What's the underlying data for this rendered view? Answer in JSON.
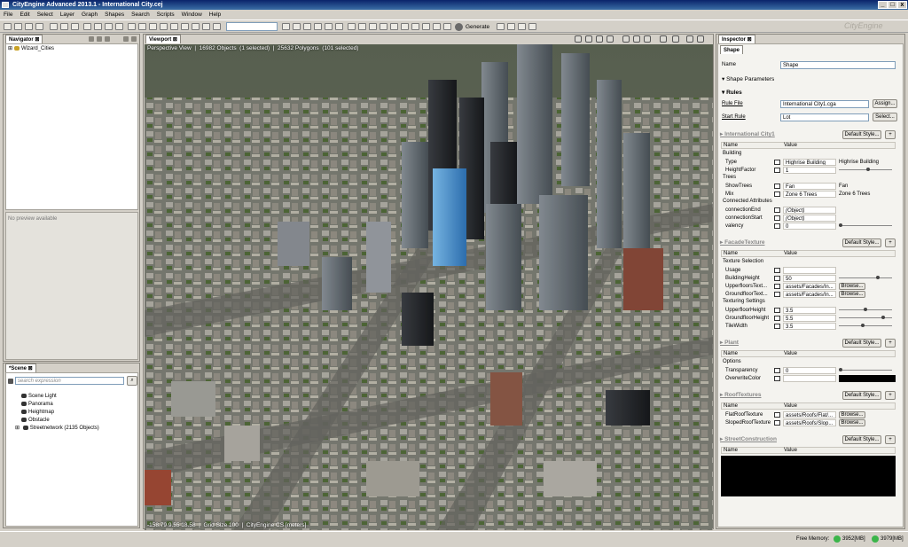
{
  "window": {
    "title": "CityEngine Advanced 2013.1 - International City.cej"
  },
  "menu": [
    "File",
    "Edit",
    "Select",
    "Layer",
    "Graph",
    "Shapes",
    "Search",
    "Scripts",
    "Window",
    "Help"
  ],
  "toolbar": {
    "generate_label": "Generate",
    "brand_watermark": "CityEngine"
  },
  "navigator": {
    "tab": "Navigator",
    "tree_root": "Wizard_Cities",
    "preview_text": "No preview available"
  },
  "scene": {
    "tab": "*Scene",
    "search_placeholder": "search expression",
    "items": [
      "Scene Light",
      "Panorama",
      "Heightmap",
      "Obstacle",
      "Streetnetwork (2135 Objects)"
    ]
  },
  "viewport": {
    "tab": "Viewport",
    "info": "Perspective View  |  16982 Objects  (1 selected)  |  25632 Polygons  (101 selected)",
    "footer": "-158.79 9.55 18.58  |  Grid Size 100  |  CityEngine CS [meters]"
  },
  "inspector": {
    "tab": "Inspector",
    "subtab": "Shape",
    "name_label": "Name",
    "name_value": "Shape",
    "shape_params": "Shape Parameters",
    "rules_header": "Rules",
    "rule_file_label": "Rule File",
    "rule_file_value": "International City1.cga",
    "assign_button": "Assign...",
    "start_rule_label": "Start Rule",
    "start_rule_value": "Lot",
    "select_button": "Select...",
    "col_name": "Name",
    "col_value": "Value",
    "default_style": "Default Style...",
    "browse": "Browse...",
    "sections": [
      {
        "title": "International City1",
        "groups": [
          {
            "label": "Building",
            "rows": [
              {
                "n": "Type",
                "v": "Highrise Building",
                "x": "Highrise Building"
              },
              {
                "n": "HeightFactor",
                "v": "1",
                "slider": 0.55
              }
            ]
          },
          {
            "label": "Trees",
            "rows": [
              {
                "n": "ShowTrees",
                "v": "Fan",
                "x": "Fan"
              },
              {
                "n": "Mix",
                "v": "Zone 6 Trees",
                "x": "Zone 6 Trees"
              }
            ]
          },
          {
            "label": "Connected Attributes",
            "rows": [
              {
                "n": "connectionEnd",
                "v": "(Object)"
              },
              {
                "n": "connectionStart",
                "v": "(Object)"
              },
              {
                "n": "valency",
                "v": "0",
                "slider": 0.0
              }
            ]
          }
        ]
      },
      {
        "title": "FacadeTexture",
        "groups": [
          {
            "label": "Texture Selection",
            "rows": [
              {
                "n": "Usage",
                "v": ""
              },
              {
                "n": "BuildingHeight",
                "v": "50",
                "slider": 0.75
              },
              {
                "n": "UpperfloorsText...",
                "v": "assets/Facades/In...",
                "browse": true
              },
              {
                "n": "GroundfloorText...",
                "v": "assets/Facades/In...",
                "browse": true
              }
            ]
          },
          {
            "label": "Texturing Settings",
            "rows": [
              {
                "n": "UpperfloorHeight",
                "v": "3.5",
                "slider": 0.5
              },
              {
                "n": "GroundfloorHeight",
                "v": "5.5",
                "slider": 0.85
              },
              {
                "n": "TileWidth",
                "v": "3.5",
                "slider": 0.45
              }
            ]
          }
        ]
      },
      {
        "title": "Plant",
        "groups": [
          {
            "label": "Options",
            "rows": [
              {
                "n": "Transparency",
                "v": "0",
                "slider": 0.0
              },
              {
                "n": "OverwriteColor",
                "v": "",
                "color": "#000000"
              }
            ]
          }
        ]
      },
      {
        "title": "RoofTextures",
        "groups": [
          {
            "label": "",
            "rows": [
              {
                "n": "FlatRoofTexture",
                "v": "assets/Roofs/Flat/...",
                "browse": true
              },
              {
                "n": "SlopedRoofTexture",
                "v": "assets/Roofs/Slop...",
                "browse": true
              }
            ]
          }
        ]
      },
      {
        "title": "StreetConstruction",
        "groups": []
      }
    ]
  },
  "status": {
    "free_memory_label": "Free Memory:",
    "mem1": "3952[MB]",
    "mem2": "3979[MB]"
  },
  "colors": {
    "accent_green": "#3bb54a",
    "title_blue": "#0a246a",
    "selected_building": "#3a8fd8"
  }
}
